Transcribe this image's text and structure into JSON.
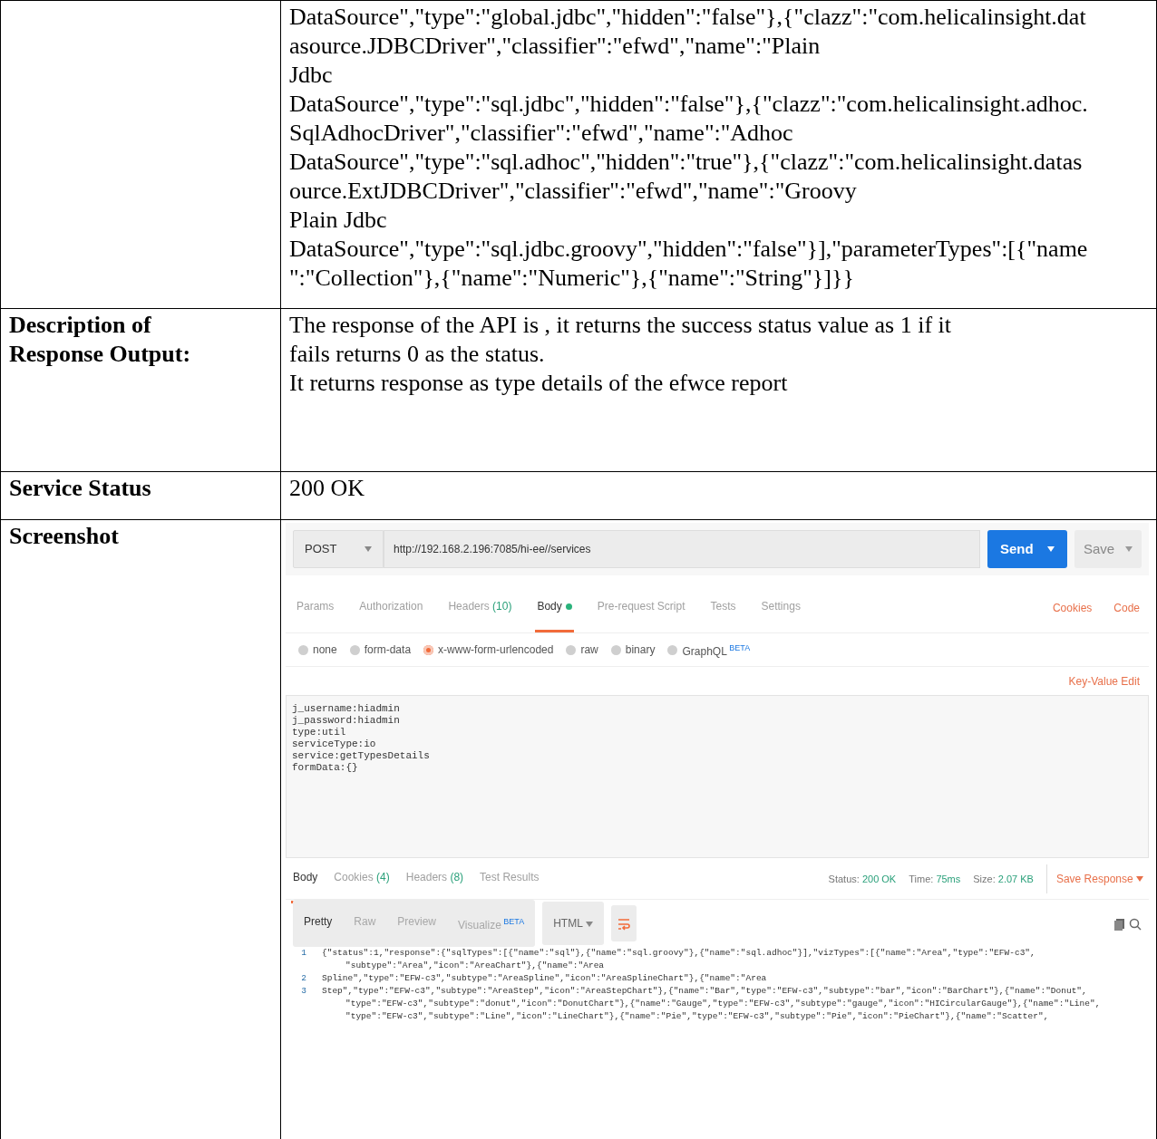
{
  "rows": [
    {
      "label": "",
      "text": "DataSource\",\"type\":\"global.jdbc\",\"hidden\":\"false\"},{\"clazz\":\"com.helicalinsight.dat\nasource.JDBCDriver\",\"classifier\":\"efwd\",\"name\":\"Plain\nJdbc\nDataSource\",\"type\":\"sql.jdbc\",\"hidden\":\"false\"},{\"clazz\":\"com.helicalinsight.adhoc.\nSqlAdhocDriver\",\"classifier\":\"efwd\",\"name\":\"Adhoc\nDataSource\",\"type\":\"sql.adhoc\",\"hidden\":\"true\"},{\"clazz\":\"com.helicalinsight.datas\nource.ExtJDBCDriver\",\"classifier\":\"efwd\",\"name\":\"Groovy\nPlain Jdbc\nDataSource\",\"type\":\"sql.jdbc.groovy\",\"hidden\":\"false\"}],\"parameterTypes\":[{\"name\n\":\"Collection\"},{\"name\":\"Numeric\"},{\"name\":\"String\"}]}}",
      "kind": "text"
    },
    {
      "label": "Description of\nResponse Output:",
      "text": "The response of the API is , it returns the success status value as 1 if it\nfails returns 0 as the status.\nIt returns response as type details of the efwce report",
      "kind": "text"
    },
    {
      "label": "Service Status",
      "text": "200 OK",
      "kind": "text"
    },
    {
      "label": "Screenshot",
      "kind": "screenshot"
    }
  ],
  "postman": {
    "method": "POST",
    "url": "http://192.168.2.196:7085/hi-ee//services",
    "send": "Send",
    "save": "Save",
    "request_tabs": [
      {
        "label": "Params",
        "selected": false
      },
      {
        "label": "Authorization",
        "selected": false
      },
      {
        "label": "Headers",
        "count": "(10)",
        "selected": false
      },
      {
        "label": "Body",
        "dot": true,
        "selected": true
      },
      {
        "label": "Pre-request Script",
        "selected": false
      },
      {
        "label": "Tests",
        "selected": false
      },
      {
        "label": "Settings",
        "selected": false
      }
    ],
    "links": [
      "Cookies",
      "Code"
    ],
    "body_types": [
      {
        "label": "none",
        "selected": false
      },
      {
        "label": "form-data",
        "selected": false
      },
      {
        "label": "x-www-form-urlencoded",
        "selected": true
      },
      {
        "label": "raw",
        "selected": false
      },
      {
        "label": "binary",
        "selected": false
      },
      {
        "label": "GraphQL",
        "badge": "BETA",
        "selected": false
      }
    ],
    "key_value_edit": "Key-Value Edit",
    "body_text": "j_username:hiadmin\nj_password:hiadmin\ntype:util\nserviceType:io\nservice:getTypesDetails\nformData:{}",
    "response_tabs": [
      {
        "label": "Body",
        "selected": true
      },
      {
        "label": "Cookies",
        "count": "(4)",
        "selected": false
      },
      {
        "label": "Headers",
        "count": "(8)",
        "selected": false
      },
      {
        "label": "Test Results",
        "selected": false
      }
    ],
    "stats": [
      {
        "label": "Status:",
        "value": "200 OK"
      },
      {
        "label": "Time:",
        "value": "75ms"
      },
      {
        "label": "Size:",
        "value": "2.07 KB"
      }
    ],
    "save_response": "Save Response",
    "view_tabs": [
      {
        "label": "Pretty",
        "selected": true
      },
      {
        "label": "Raw",
        "selected": false
      },
      {
        "label": "Preview",
        "selected": false
      },
      {
        "label": "Visualize",
        "badge": "BETA",
        "selected": false
      }
    ],
    "format": "HTML",
    "code_lines": [
      {
        "number": "1",
        "segments": [
          "{\"status\":1,\"response\":{\"sqlTypes\":[{\"name\":\"sql\"},{\"name\":\"sql.groovy\"},{\"name\":\"sql.adhoc\"}],\"vizTypes\":[{\"name\":\"Area\",\"type\":\"EFW-c3\",",
          "\"subtype\":\"Area\",\"icon\":\"AreaChart\"},{\"name\":\"Area"
        ]
      },
      {
        "number": "2",
        "segments": [
          "Spline\",\"type\":\"EFW-c3\",\"subtype\":\"AreaSpline\",\"icon\":\"AreaSplineChart\"},{\"name\":\"Area"
        ]
      },
      {
        "number": "3",
        "segments": [
          "Step\",\"type\":\"EFW-c3\",\"subtype\":\"AreaStep\",\"icon\":\"AreaStepChart\"},{\"name\":\"Bar\",\"type\":\"EFW-c3\",\"subtype\":\"bar\",\"icon\":\"BarChart\"},{\"name\":\"Donut\",",
          "\"type\":\"EFW-c3\",\"subtype\":\"donut\",\"icon\":\"DonutChart\"},{\"name\":\"Gauge\",\"type\":\"EFW-c3\",\"subtype\":\"gauge\",\"icon\":\"HICircularGauge\"},{\"name\":\"Line\",",
          "\"type\":\"EFW-c3\",\"subtype\":\"Line\",\"icon\":\"LineChart\"},{\"name\":\"Pie\",\"type\":\"EFW-c3\",\"subtype\":\"Pie\",\"icon\":\"PieChart\"},{\"name\":\"Scatter\","
        ]
      }
    ]
  }
}
